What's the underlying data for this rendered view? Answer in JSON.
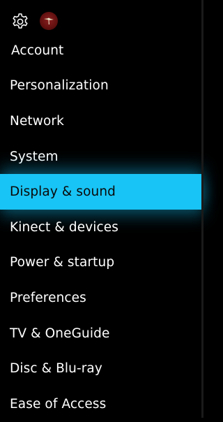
{
  "header": {
    "gear_icon": "gear-icon",
    "avatar_icon": "avatar-icon",
    "colors": {
      "avatar_bg": "#7a1616"
    }
  },
  "menu": {
    "items": [
      {
        "label": "Account",
        "selected": false
      },
      {
        "label": "Personalization",
        "selected": false
      },
      {
        "label": "Network",
        "selected": false
      },
      {
        "label": "System",
        "selected": false
      },
      {
        "label": "Display & sound",
        "selected": true
      },
      {
        "label": "Kinect & devices",
        "selected": false
      },
      {
        "label": "Power & startup",
        "selected": false
      },
      {
        "label": "Preferences",
        "selected": false
      },
      {
        "label": "TV & OneGuide",
        "selected": false
      },
      {
        "label": "Disc & Blu-ray",
        "selected": false
      },
      {
        "label": "Ease of Access",
        "selected": false
      }
    ]
  },
  "colors": {
    "background": "#000000",
    "accent": "#18c4f5",
    "text": "#ffffff",
    "selected_text": "#0a0a0a"
  }
}
